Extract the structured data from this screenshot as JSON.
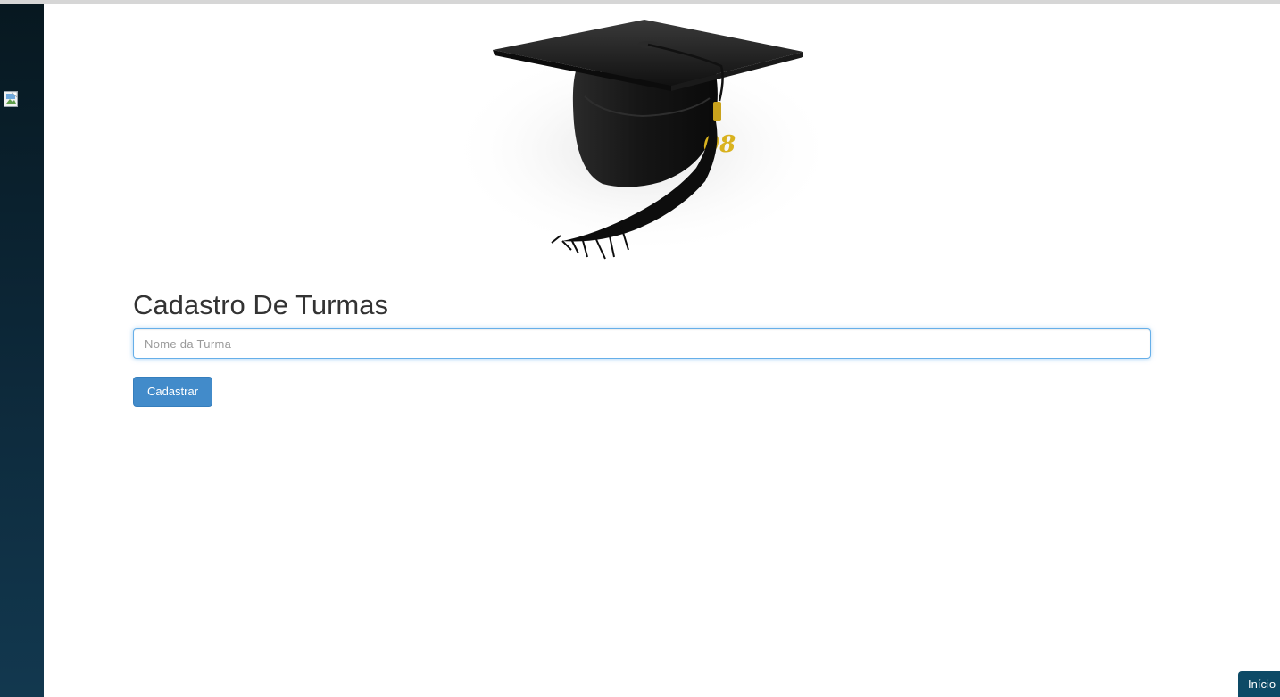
{
  "page": {
    "title": "Cadastro De Turmas"
  },
  "form": {
    "class_name_placeholder": "Nome da Turma",
    "class_name_value": "",
    "submit_label": "Cadastrar"
  },
  "footer": {
    "home_label": "Início"
  },
  "colors": {
    "sidebar_top": "#071820",
    "sidebar_bottom": "#12384f",
    "primary_button": "#428bca",
    "input_focus_border": "#66afe9",
    "home_tab": "#0d4a66"
  },
  "icons": {
    "sidebar_image": "broken-image-icon",
    "hero": "graduation-cap-image"
  }
}
